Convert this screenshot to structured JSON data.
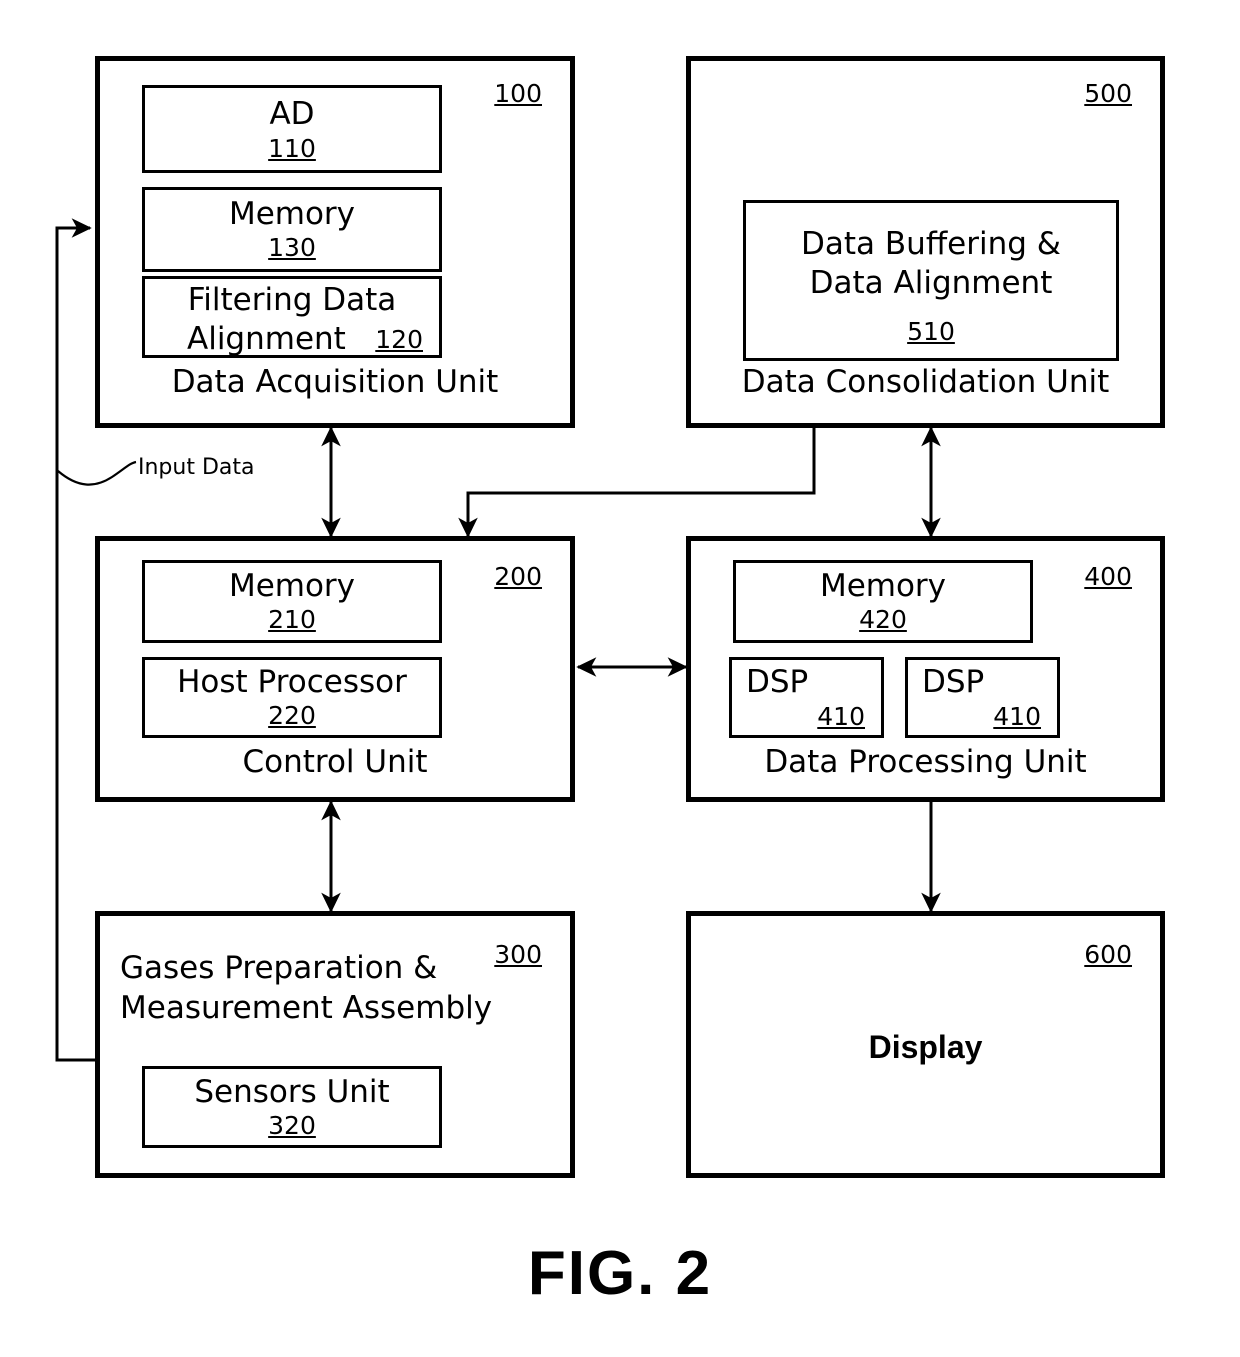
{
  "figure": {
    "caption": "FIG. 2"
  },
  "annotations": {
    "input_data_label": "Input Data"
  },
  "units": [
    {
      "id": "data-acquisition-unit",
      "name": "Data Acquisition Unit",
      "ref": "100",
      "children": [
        {
          "id": "ad",
          "label": "AD",
          "ref": "110"
        },
        {
          "id": "memory-130",
          "label": "Memory",
          "ref": "130"
        },
        {
          "id": "filtering-data-alignment",
          "label_line1": "Filtering Data",
          "label_line2": "Alignment",
          "ref": "120"
        }
      ]
    },
    {
      "id": "data-consolidation-unit",
      "name": "Data Consolidation Unit",
      "ref": "500",
      "children": [
        {
          "id": "data-buffering-data-alignment",
          "label_line1": "Data Buffering &",
          "label_line2": "Data Alignment",
          "ref": "510"
        }
      ]
    },
    {
      "id": "control-unit",
      "name": "Control Unit",
      "ref": "200",
      "children": [
        {
          "id": "memory-210",
          "label": "Memory",
          "ref": "210"
        },
        {
          "id": "host-processor",
          "label": "Host Processor",
          "ref": "220"
        }
      ]
    },
    {
      "id": "data-processing-unit",
      "name": "Data Processing Unit",
      "ref": "400",
      "children": [
        {
          "id": "memory-420",
          "label": "Memory",
          "ref": "420"
        },
        {
          "id": "dsp-left",
          "label": "DSP",
          "ref": "410"
        },
        {
          "id": "dsp-right",
          "label": "DSP",
          "ref": "410"
        }
      ]
    },
    {
      "id": "gases-preparation-measurement-assembly",
      "name_line1": "Gases Preparation &",
      "name_line2": "Measurement Assembly",
      "ref": "300",
      "children": [
        {
          "id": "sensors-unit",
          "label": "Sensors Unit",
          "ref": "320"
        }
      ]
    },
    {
      "id": "display",
      "name": "Display",
      "ref": "600",
      "children": []
    }
  ],
  "colors": {
    "stroke": "#000000",
    "background": "#ffffff"
  }
}
